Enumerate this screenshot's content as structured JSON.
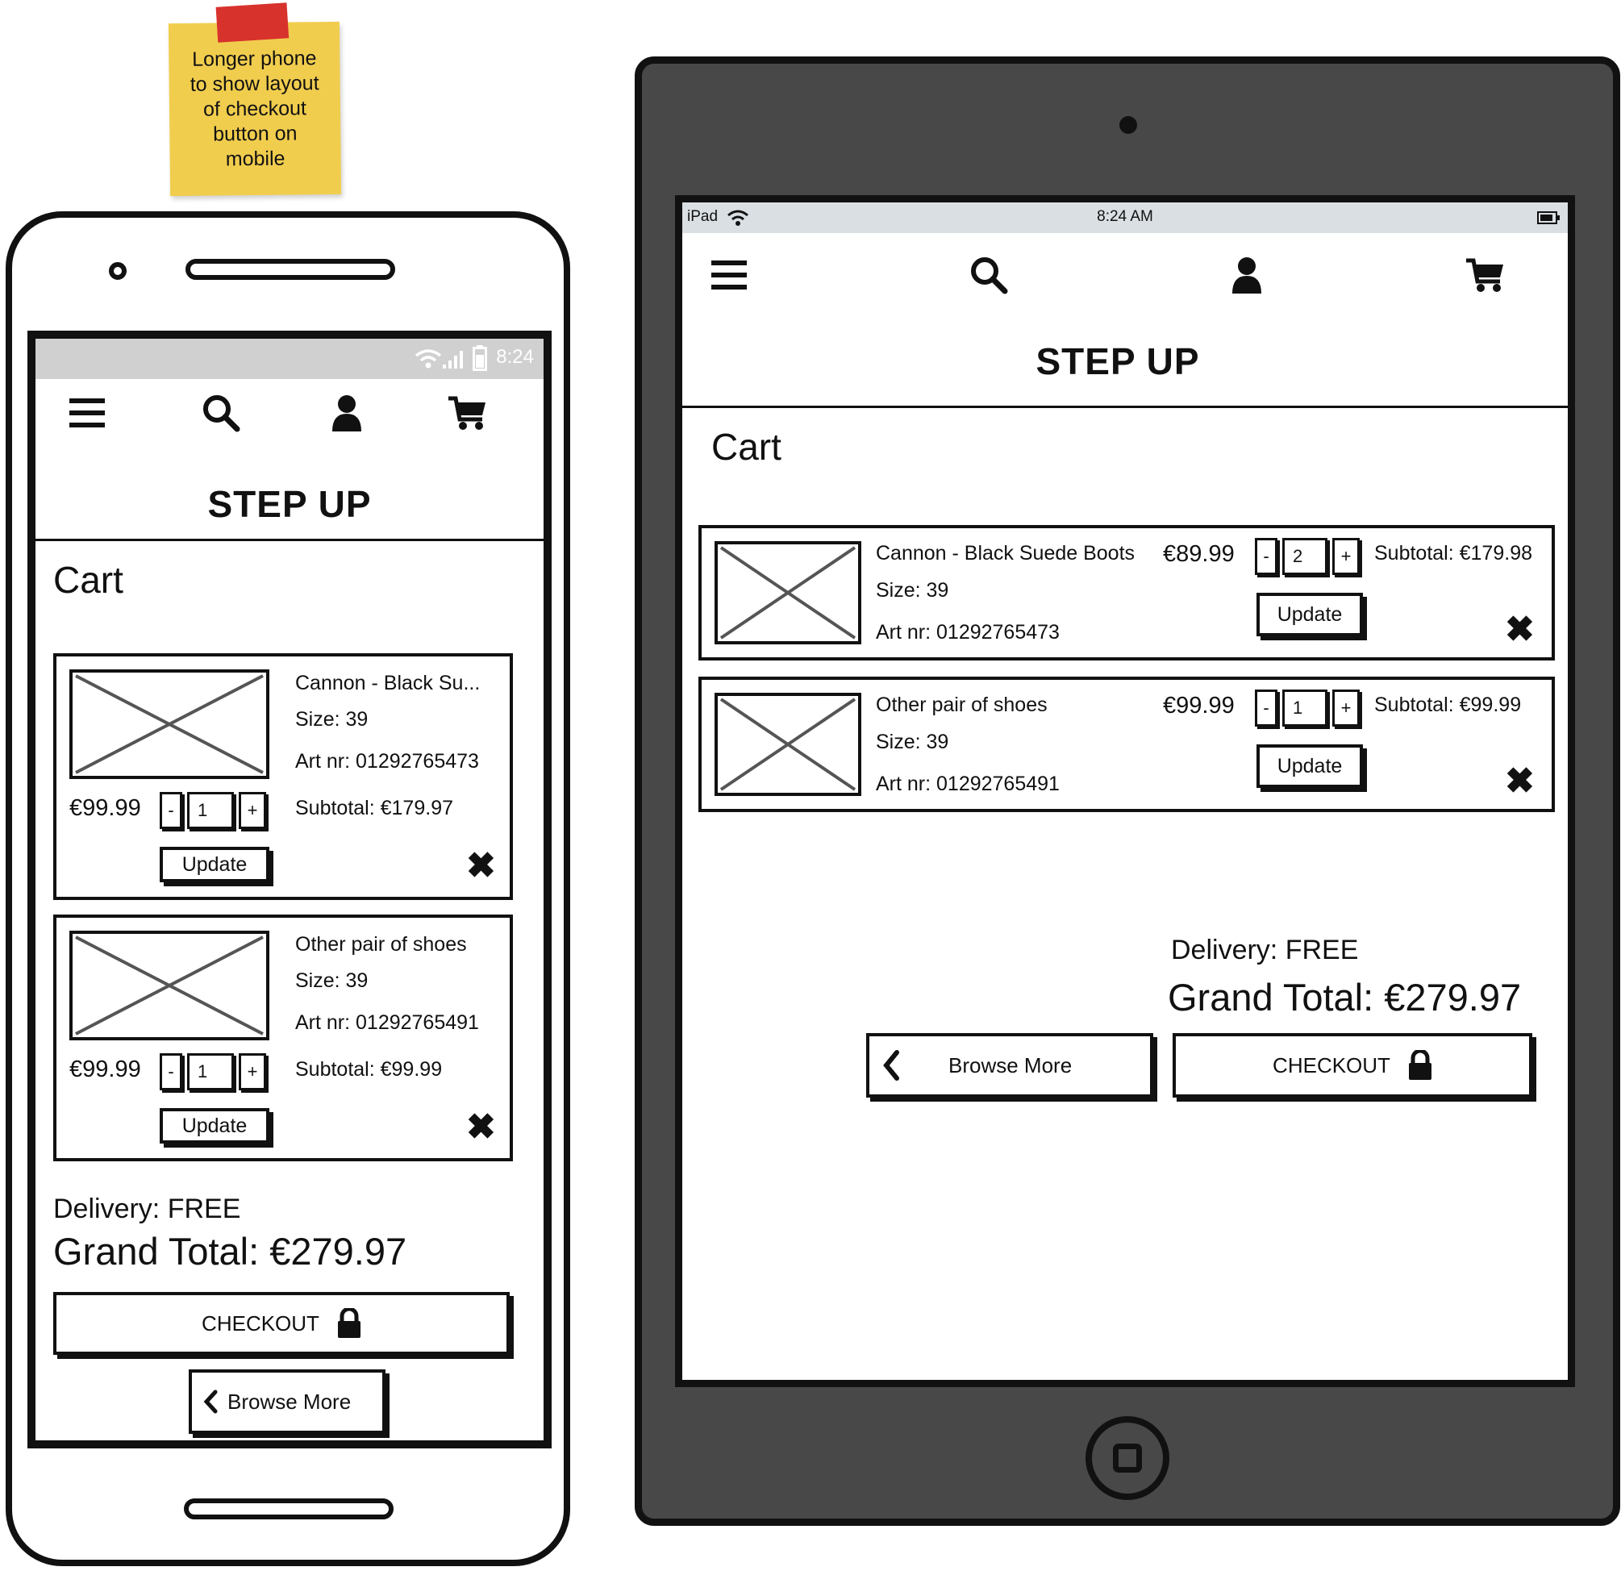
{
  "note": {
    "text": "Longer phone\nto show layout\nof checkout\nbutton on\nmobile",
    "color": "#f1cd4e"
  },
  "phone": {
    "status": {
      "time": "8:24",
      "icons": [
        "wifi-icon",
        "signal-icon",
        "battery-icon"
      ]
    },
    "nav": [
      "menu-icon",
      "search-icon",
      "user-icon",
      "cart-icon"
    ],
    "brand": "STEP UP",
    "heading": "Cart",
    "items": [
      {
        "name": "Cannon - Black Su...",
        "size": "Size: 39",
        "art": "Art nr: 01292765473",
        "price": "€99.99",
        "minus": "-",
        "qty": "1",
        "plus": "+",
        "subtotal": "Subtotal: €179.97",
        "update": "Update"
      },
      {
        "name": "Other pair of shoes",
        "size": "Size: 39",
        "art": "Art nr: 01292765491",
        "price": "€99.99",
        "minus": "-",
        "qty": "1",
        "plus": "+",
        "subtotal": "Subtotal: €99.99",
        "update": "Update"
      }
    ],
    "delivery": "Delivery: FREE",
    "grand_total": "Grand Total: €279.97",
    "checkout": "CHECKOUT",
    "browse": "Browse More"
  },
  "tablet": {
    "status": {
      "device": "iPad",
      "time": "8:24 AM"
    },
    "nav": [
      "menu-icon",
      "search-icon",
      "user-icon",
      "cart-icon"
    ],
    "brand": "STEP UP",
    "heading": "Cart",
    "items": [
      {
        "name": "Cannon - Black Suede Boots",
        "size": "Size: 39",
        "art": "Art nr: 01292765473",
        "price": "€89.99",
        "minus": "-",
        "qty": "2",
        "plus": "+",
        "subtotal": "Subtotal: €179.98",
        "update": "Update"
      },
      {
        "name": "Other pair of shoes",
        "size": "Size: 39",
        "art": "Art nr: 01292765491",
        "price": "€99.99",
        "minus": "-",
        "qty": "1",
        "plus": "+",
        "subtotal": "Subtotal: €99.99",
        "update": "Update"
      }
    ],
    "delivery": "Delivery: FREE",
    "grand_total": "Grand Total: €279.97",
    "browse": "Browse More",
    "checkout": "CHECKOUT"
  }
}
